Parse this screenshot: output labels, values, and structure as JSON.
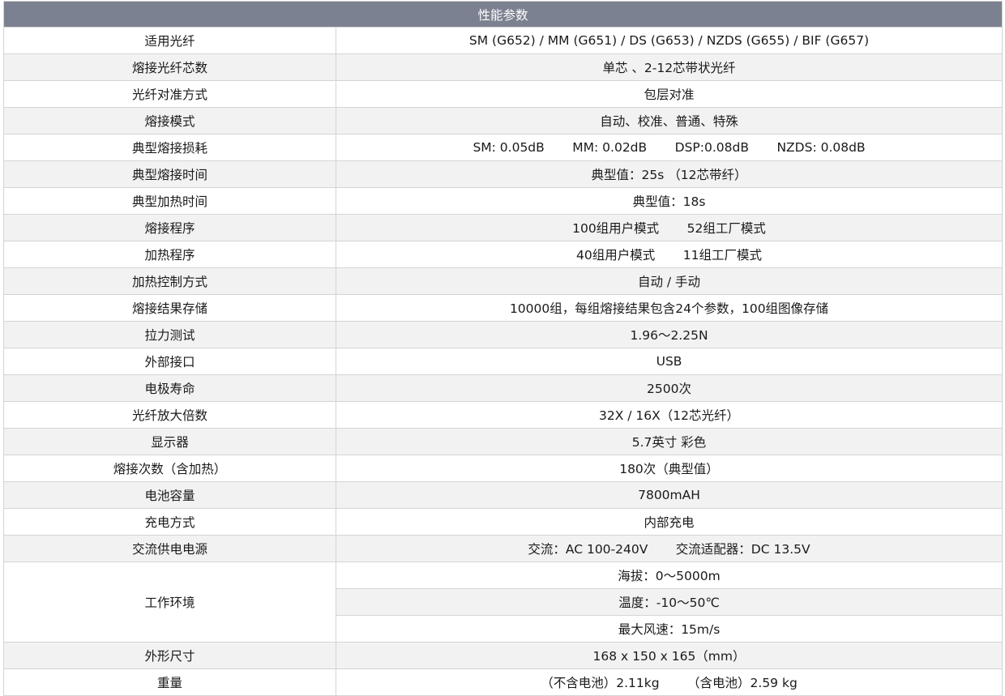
{
  "header": "性能参数",
  "rows": [
    {
      "label": "适用光纤",
      "value": "SM (G652) / MM (G651) / DS (G653) / NZDS (G655) / BIF (G657)"
    },
    {
      "label": "熔接光纤芯数",
      "value": "单芯 、2-12芯带状光纤"
    },
    {
      "label": "光纤对准方式",
      "value": "包层对准"
    },
    {
      "label": "熔接模式",
      "value": "自动、校准、普通、特殊"
    },
    {
      "label": "典型熔接损耗",
      "value": "SM: 0.05dB       MM: 0.02dB       DSP:0.08dB       NZDS: 0.08dB"
    },
    {
      "label": "典型熔接时间",
      "value": "典型值：25s （12芯带纤）"
    },
    {
      "label": "典型加热时间",
      "value": "典型值：18s"
    },
    {
      "label": "熔接程序",
      "value": "100组用户模式       52组工厂模式"
    },
    {
      "label": "加热程序",
      "value": "40组用户模式       11组工厂模式"
    },
    {
      "label": "加热控制方式",
      "value": "自动 / 手动"
    },
    {
      "label": "熔接结果存储",
      "value": "10000组，每组熔接结果包含24个参数，100组图像存储"
    },
    {
      "label": "拉力测试",
      "value": "1.96～2.25N"
    },
    {
      "label": "外部接口",
      "value": "USB"
    },
    {
      "label": "电极寿命",
      "value": "2500次"
    },
    {
      "label": "光纤放大倍数",
      "value": "32X / 16X（12芯光纤）"
    },
    {
      "label": "显示器",
      "value": "5.7英寸 彩色"
    },
    {
      "label": "熔接次数（含加热）",
      "value": "180次（典型值）"
    },
    {
      "label": "电池容量",
      "value": "7800mAH"
    },
    {
      "label": "充电方式",
      "value": "内部充电"
    },
    {
      "label": "交流供电电源",
      "value": "交流：AC 100-240V       交流适配器：DC 13.5V"
    }
  ],
  "environment": {
    "label": "工作环境",
    "values": [
      "海拔：0～5000m",
      "温度：-10～50℃",
      "最大风速：15m/s"
    ]
  },
  "tail_rows": [
    {
      "label": "外形尺寸",
      "value": "168 x 150 x 165（mm）"
    },
    {
      "label": "重量",
      "value": "（不含电池）2.11kg       （含电池）2.59 kg"
    }
  ]
}
